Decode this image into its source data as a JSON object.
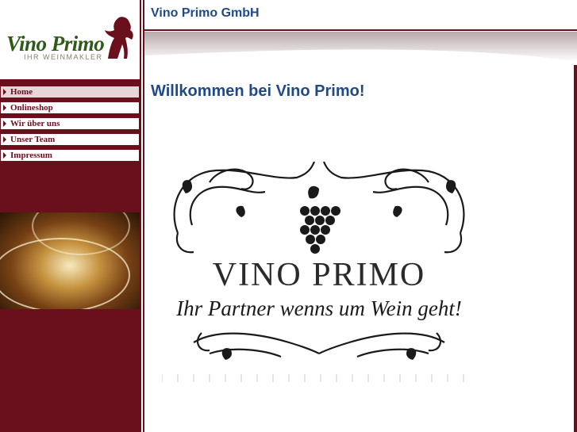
{
  "logo": {
    "name": "Vino Primo",
    "tagline": "IHR WEINMAKLER"
  },
  "nav": {
    "items": [
      {
        "label": "Home",
        "active": true
      },
      {
        "label": "Onlineshop"
      },
      {
        "label": "Wir über uns"
      },
      {
        "label": "Unser Team"
      },
      {
        "label": "Impressum"
      }
    ]
  },
  "header": {
    "company": "Vino Primo GmbH"
  },
  "main": {
    "heading": "Willkommen bei Vino Primo!",
    "emblem_title": "VINO PRIMO",
    "emblem_subtitle": "Ihr Partner wenns um Wein geht!"
  },
  "colors": {
    "brand_maroon": "#6a0f1c",
    "heading_blue": "#1f4a86",
    "logo_green": "#2f5a1a"
  }
}
